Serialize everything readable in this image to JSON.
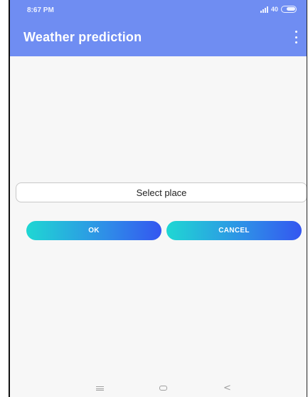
{
  "status_bar": {
    "time": "8:67 PM",
    "network": "40",
    "battery_level": 0.7
  },
  "app_bar": {
    "title": "Weather prediction",
    "menu_icon": "overflow-menu-icon"
  },
  "place_select": {
    "label": "Select place"
  },
  "buttons": {
    "ok_label": "OK",
    "cancel_label": "CANCEL"
  },
  "nav_bar": {
    "menu_icon": "menu-icon",
    "home_icon": "home-icon",
    "back_icon": "back-icon",
    "back_glyph": "<"
  },
  "colors": {
    "app_bar": "#6f8df2",
    "button_gradient_start": "#1fd7d3",
    "button_gradient_end": "#3456f0",
    "background": "#f7f7f7"
  }
}
